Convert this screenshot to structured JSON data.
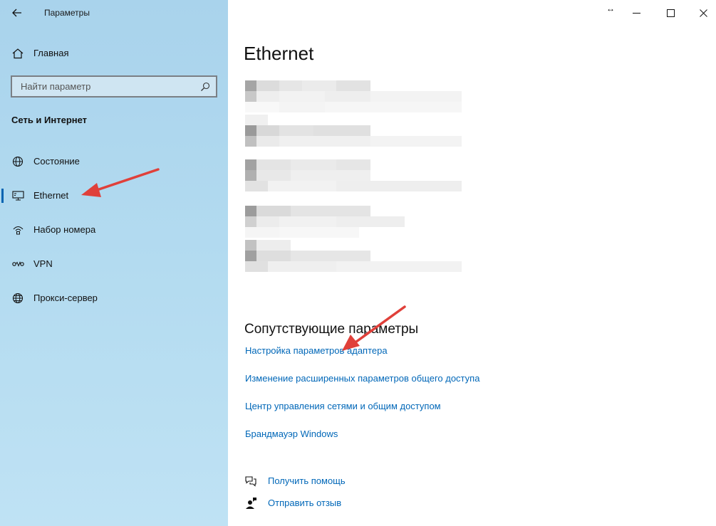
{
  "window": {
    "title": "Параметры",
    "resize_glyph": "↔"
  },
  "sidebar": {
    "home_label": "Главная",
    "search_placeholder": "Найти параметр",
    "section_title": "Сеть и Интернет",
    "items": [
      {
        "label": "Состояние",
        "icon": "globe-status-icon",
        "selected": false
      },
      {
        "label": "Ethernet",
        "icon": "ethernet-monitor-icon",
        "selected": true
      },
      {
        "label": "Набор номера",
        "icon": "dialup-icon",
        "selected": false
      },
      {
        "label": "VPN",
        "icon": "vpn-icon",
        "selected": false
      },
      {
        "label": "Прокси-сервер",
        "icon": "globe-icon",
        "selected": false
      }
    ]
  },
  "main": {
    "title": "Ethernet",
    "related_title": "Сопутствующие параметры",
    "links": [
      "Настройка параметров адаптера",
      "Изменение расширенных параметров общего доступа",
      "Центр управления сетями и общим доступом",
      "Брандмауэр Windows"
    ],
    "help": {
      "get_help": "Получить помощь",
      "feedback": "Отправить отзыв"
    }
  },
  "colors": {
    "accent": "#0063b1",
    "link": "#0067b8",
    "sidebar_bg": "#b3dbf0",
    "annotation_arrow": "#e0403a"
  }
}
